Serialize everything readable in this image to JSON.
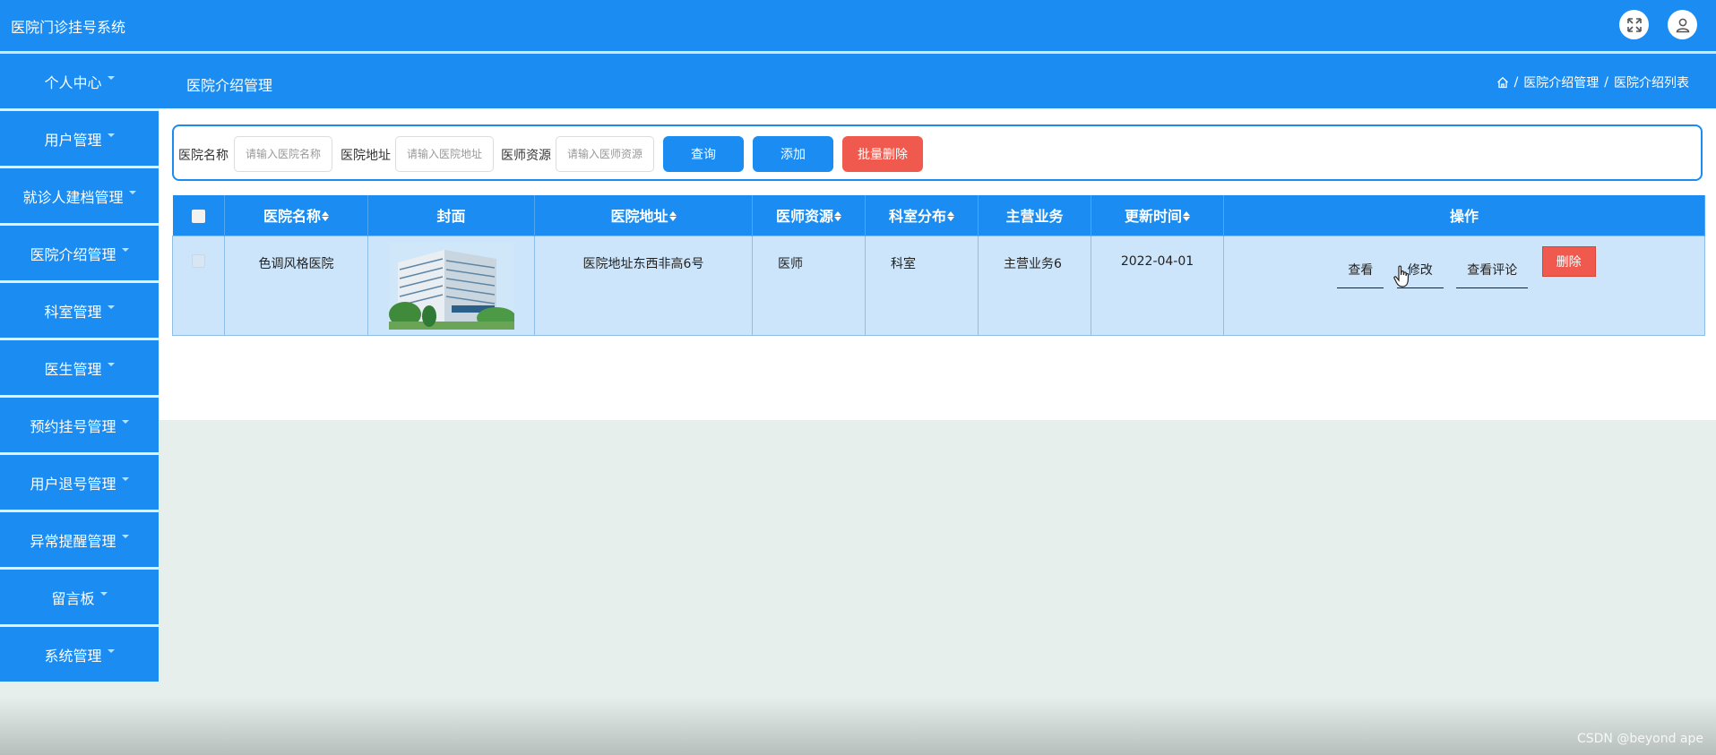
{
  "app": {
    "title": "医院门诊挂号系统"
  },
  "sidebar": {
    "items": [
      {
        "label": "个人中心"
      },
      {
        "label": "用户管理"
      },
      {
        "label": "就诊人建档管理"
      },
      {
        "label": "医院介绍管理"
      },
      {
        "label": "科室管理"
      },
      {
        "label": "医生管理"
      },
      {
        "label": "预约挂号管理"
      },
      {
        "label": "用户退号管理"
      },
      {
        "label": "异常提醒管理"
      },
      {
        "label": "留言板"
      },
      {
        "label": "系统管理"
      }
    ]
  },
  "header": {
    "page_title": "医院介绍管理",
    "breadcrumb": {
      "sep": "/",
      "level1": "医院介绍管理",
      "level2": "医院介绍列表"
    }
  },
  "search": {
    "name_label": "医院名称",
    "name_placeholder": "请输入医院名称",
    "address_label": "医院地址",
    "address_placeholder": "请输入医院地址",
    "doctor_label": "医师资源",
    "doctor_placeholder": "请输入医师资源",
    "query_button": "查询",
    "add_button": "添加",
    "batch_delete_button": "批量删除"
  },
  "table": {
    "columns": [
      "医院名称",
      "封面",
      "医院地址",
      "医师资源",
      "科室分布",
      "主营业务",
      "更新时间",
      "操作"
    ],
    "rows": [
      {
        "name": "色调风格医院",
        "address": "医院地址东西非高6号",
        "doctor": "医师",
        "dept": "科室",
        "business": "主营业务6",
        "updated": "2022-04-01"
      }
    ],
    "actions": {
      "view": "查看",
      "edit": "修改",
      "comments": "查看评论",
      "delete": "删除"
    }
  },
  "watermark": "CSDN @beyond ape",
  "colors": {
    "primary": "#1a8cf2",
    "danger": "#f05a4e",
    "row_bg": "#cce5fa"
  }
}
